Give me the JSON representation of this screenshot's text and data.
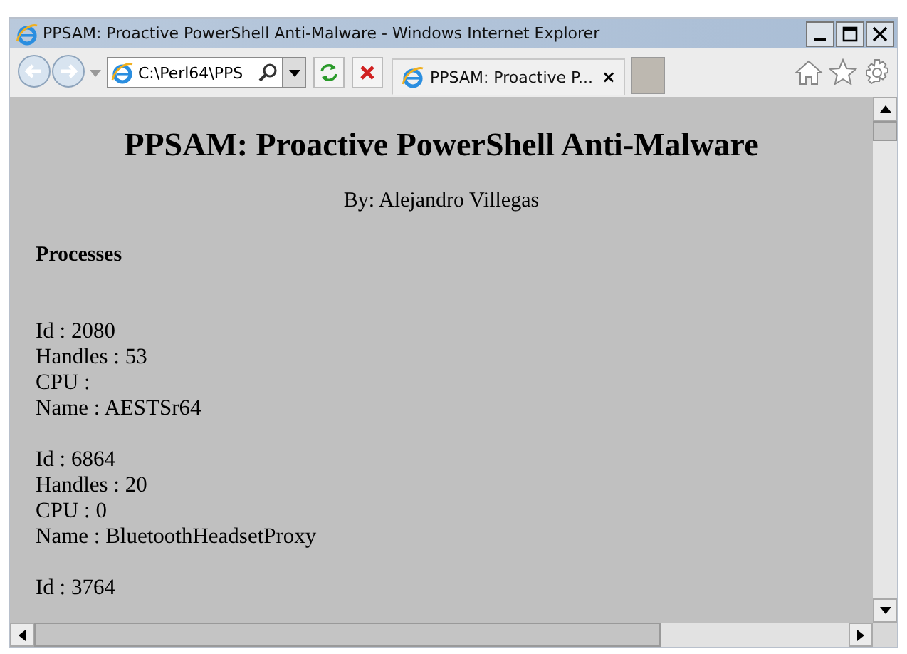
{
  "window": {
    "title": "PPSAM: Proactive PowerShell Anti-Malware - Windows Internet Explorer"
  },
  "address_bar": {
    "value": "C:\\Perl64\\PPS"
  },
  "tabs": [
    {
      "label": "PPSAM: Proactive P...",
      "close": "×",
      "selected": true
    }
  ],
  "page": {
    "heading": "PPSAM: Proactive PowerShell Anti-Malware",
    "byline": "By: Alejandro Villegas",
    "section": "Processes",
    "records": [
      {
        "lines": [
          "Id : 2080",
          "Handles : 53",
          "CPU :",
          "Name : AESTSr64"
        ]
      },
      {
        "lines": [
          "Id : 6864",
          "Handles : 20",
          "CPU : 0",
          "Name : BluetoothHeadsetProxy"
        ]
      },
      {
        "lines": [
          "Id : 3764"
        ]
      }
    ]
  }
}
